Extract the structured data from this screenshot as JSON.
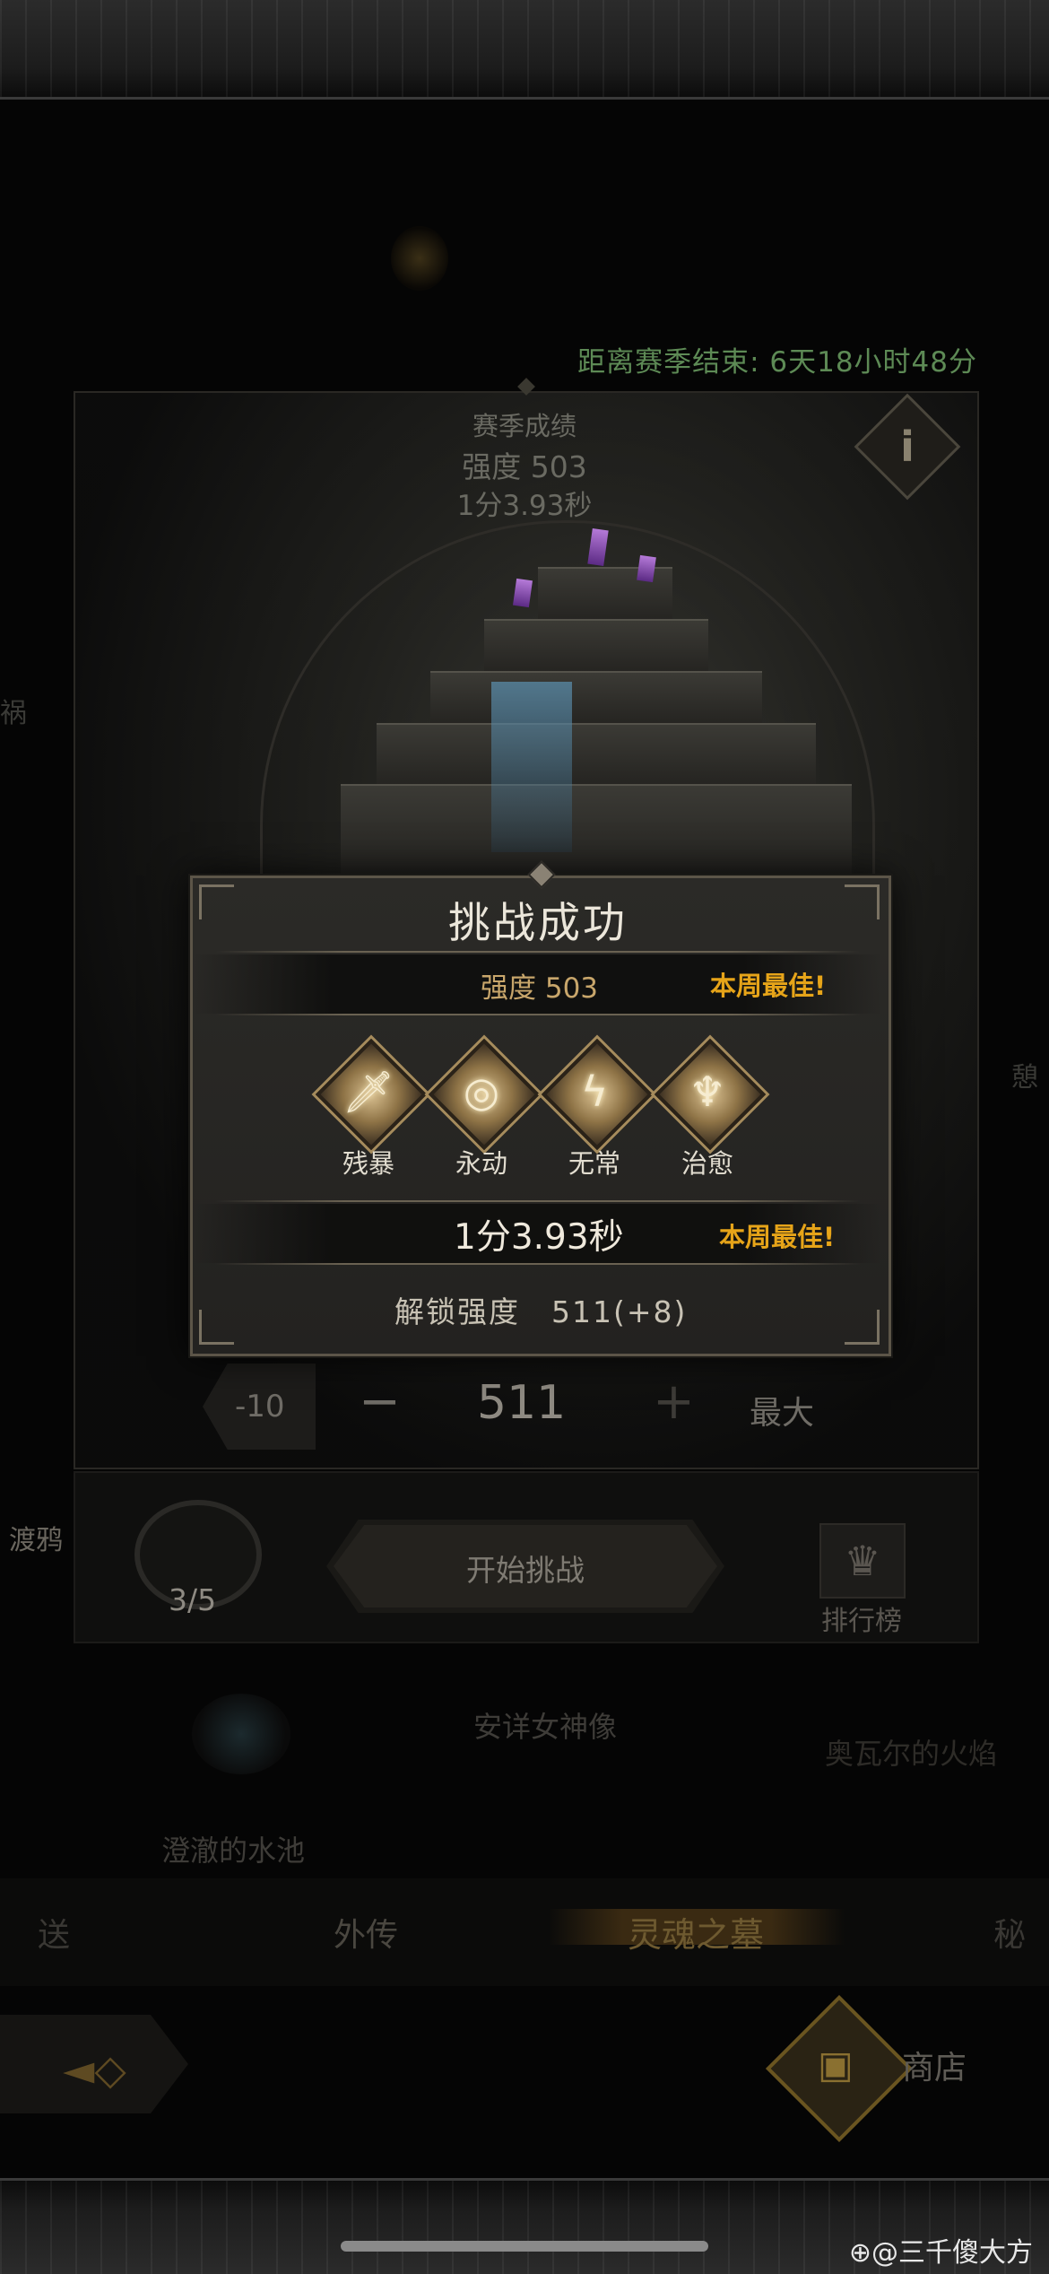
{
  "season": {
    "countdown": "距离赛季结束: 6天18小时48分",
    "record_title": "赛季成绩",
    "record_strength": "强度 503",
    "record_time": "1分3.93秒"
  },
  "side_labels": {
    "left_partial_1": "祸",
    "left_partial_2": "渡鸦",
    "right_partial": "憩"
  },
  "modal": {
    "title": "挑战成功",
    "strength": "强度 503",
    "strength_badge": "本周最佳!",
    "traits": [
      {
        "label": "残暴",
        "icon": "sword-icon",
        "glyph": "🗡"
      },
      {
        "label": "永动",
        "icon": "shield-swirl-icon",
        "glyph": "◎"
      },
      {
        "label": "无常",
        "icon": "lightning-orb-icon",
        "glyph": "ϟ"
      },
      {
        "label": "治愈",
        "icon": "flame-heal-icon",
        "glyph": "♆"
      }
    ],
    "time": "1分3.93秒",
    "time_badge": "本周最佳!",
    "unlock": "解锁强度　511(+8)"
  },
  "controls": {
    "minus10": "-10",
    "minus": "−",
    "value": "511",
    "plus": "+",
    "max": "最大"
  },
  "actions": {
    "attempts": "3/5",
    "start": "开始挑战",
    "ranking": "排行榜"
  },
  "map_labels": {
    "statue": "安详女神像",
    "pool": "澄澈的水池",
    "fire": "奥瓦尔的火焰"
  },
  "tabs": {
    "left_partial": "送",
    "side_story": "外传",
    "active": "灵魂之墓",
    "right_partial": "秘"
  },
  "footer": {
    "shop": "商店",
    "watermark": "⊕@三千傻大方"
  },
  "colors": {
    "gold": "#e6a419",
    "countdown_green": "#5d8a55",
    "modal_bg": "#2b2a27"
  }
}
